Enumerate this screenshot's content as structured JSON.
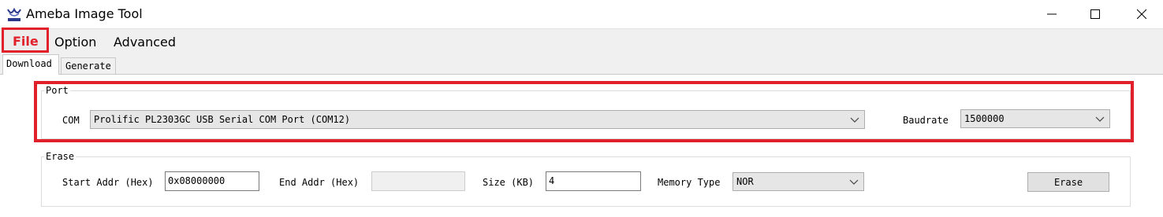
{
  "window": {
    "title": "Ameba Image Tool",
    "icon": "ameba-logo-icon",
    "controls": [
      "minimize-icon",
      "maximize-icon",
      "close-icon"
    ]
  },
  "menu": {
    "items": [
      {
        "label": "File"
      },
      {
        "label": "Option"
      },
      {
        "label": "Advanced"
      }
    ]
  },
  "tabs": [
    {
      "label": "Download"
    },
    {
      "label": "Generate"
    }
  ],
  "port_group": {
    "legend": "Port",
    "com_label": "COM",
    "com_value": "Prolific PL2303GC USB Serial COM Port (COM12)",
    "baud_label": "Baudrate",
    "baud_value": "1500000"
  },
  "erase_group": {
    "legend": "Erase",
    "start_label": "Start Addr (Hex)",
    "start_value": "0x08000000",
    "end_label": "End Addr (Hex)",
    "end_value": "",
    "size_label": "Size (KB)",
    "size_value": "4",
    "mem_label": "Memory Type",
    "mem_value": "NOR",
    "erase_button": "Erase"
  },
  "annotation_color": "#e0202a"
}
